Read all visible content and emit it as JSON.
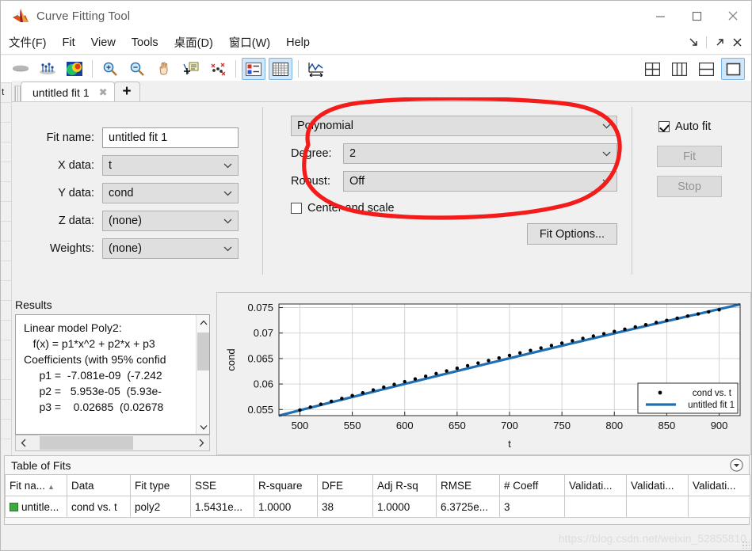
{
  "window": {
    "title": "Curve Fitting Tool",
    "logo_icon": "matlab-logo-icon",
    "minimize_icon": "minimize-icon",
    "maximize_icon": "maximize-icon",
    "close_icon": "close-icon"
  },
  "menubar": {
    "items": [
      {
        "label": "文件(F)",
        "name": "menu-file"
      },
      {
        "label": "Fit",
        "name": "menu-fit"
      },
      {
        "label": "View",
        "name": "menu-view"
      },
      {
        "label": "Tools",
        "name": "menu-tools"
      },
      {
        "label": "桌面(D)",
        "name": "menu-desktop"
      },
      {
        "label": "窗口(W)",
        "name": "menu-window"
      },
      {
        "label": "Help",
        "name": "menu-help"
      }
    ],
    "right_buttons": [
      {
        "name": "dock-arrow-icon"
      },
      {
        "name": "undock-arrow-icon"
      },
      {
        "name": "close-panel-icon"
      }
    ]
  },
  "toolbar": {
    "buttons": [
      {
        "name": "surface-plot-icon"
      },
      {
        "name": "residuals-plot-icon"
      },
      {
        "name": "contour-plot-icon"
      },
      {
        "name": "zoom-in-icon"
      },
      {
        "name": "zoom-out-icon"
      },
      {
        "name": "pan-icon"
      },
      {
        "name": "data-cursor-icon"
      },
      {
        "name": "exclude-outliers-icon"
      },
      {
        "name": "legend-toggle-icon"
      },
      {
        "name": "grid-toggle-icon"
      },
      {
        "name": "axis-limits-icon"
      }
    ],
    "selected": [
      "legend-toggle-icon",
      "grid-toggle-icon"
    ],
    "layout_buttons": [
      {
        "name": "layout-four-pane-icon",
        "selected": false
      },
      {
        "name": "layout-two-column-icon",
        "selected": false
      },
      {
        "name": "layout-two-row-icon",
        "selected": false
      },
      {
        "name": "layout-single-pane-icon",
        "selected": true
      }
    ]
  },
  "tabs": {
    "items": [
      {
        "label": "untitled fit 1",
        "close_icon": "tab-close-icon"
      }
    ],
    "add_label": "+"
  },
  "fit_form": {
    "fit_name_label": "Fit name:",
    "fit_name_value": "untitled fit 1",
    "x_data_label": "X data:",
    "x_data_value": "t",
    "y_data_label": "Y data:",
    "y_data_value": "cond",
    "z_data_label": "Z data:",
    "z_data_value": "(none)",
    "weights_label": "Weights:",
    "weights_value": "(none)"
  },
  "fit_type": {
    "model_value": "Polynomial",
    "degree_label": "Degree:",
    "degree_value": "2",
    "robust_label": "Robust:",
    "robust_value": "Off",
    "center_scale_label": "Center and scale",
    "center_scale_checked": false,
    "fit_options_label": "Fit Options..."
  },
  "fit_actions": {
    "auto_fit_label": "Auto fit",
    "auto_fit_checked": true,
    "fit_button_label": "Fit",
    "stop_button_label": "Stop"
  },
  "results": {
    "title": "Results",
    "text": "Linear model Poly2:\n   f(x) = p1*x^2 + p2*x + p3\nCoefficients (with 95% confid\n     p1 =  -7.081e-09  (-7.242\n     p2 =   5.953e-05  (5.93e-\n     p3 =    0.02685  (0.02678",
    "scroll_up_icon": "scroll-up-icon",
    "scroll_down_icon": "scroll-down-icon",
    "scroll_left_icon": "scroll-left-icon",
    "scroll_right_icon": "scroll-right-icon"
  },
  "table_of_fits": {
    "title": "Table of Fits",
    "collapse_icon": "collapse-down-icon",
    "columns": [
      "Fit na...",
      "Data",
      "Fit type",
      "SSE",
      "R-square",
      "DFE",
      "Adj R-sq",
      "RMSE",
      "# Coeff",
      "Validati...",
      "Validati...",
      "Validati..."
    ],
    "sorted_column": "Fit na...",
    "rows": [
      {
        "swatch_color": "#3faa3f",
        "cells": [
          "untitle...",
          "cond vs. t",
          "poly2",
          "1.5431e...",
          "1.0000",
          "38",
          "1.0000",
          "6.3725e...",
          "3",
          "",
          "",
          ""
        ]
      }
    ]
  },
  "annotation": {
    "type": "red-ellipse-highlight",
    "color": "#f41b1b"
  },
  "watermark": {
    "text": "https://blog.csdn.net/weixin_52855810"
  },
  "chart_data": {
    "type": "scatter",
    "title": "",
    "xlabel": "t",
    "ylabel": "cond",
    "xlim": [
      480,
      920
    ],
    "ylim": [
      0.0538,
      0.0757
    ],
    "xticks": [
      500,
      550,
      600,
      650,
      700,
      750,
      800,
      850,
      900
    ],
    "yticks": [
      0.055,
      0.06,
      0.065,
      0.07,
      0.075
    ],
    "ytick_labels": [
      "0.055",
      "0.06",
      "0.065",
      "0.07",
      "0.075"
    ],
    "grid": true,
    "legend_position": "lower right",
    "series": [
      {
        "name": "cond vs. t",
        "type": "scatter",
        "marker": "circle",
        "color": "#000000",
        "x": [
          500,
          510,
          520,
          530,
          540,
          550,
          560,
          570,
          580,
          590,
          600,
          610,
          620,
          630,
          640,
          650,
          660,
          670,
          680,
          690,
          700,
          710,
          720,
          730,
          740,
          750,
          760,
          770,
          780,
          790,
          800,
          810,
          820,
          830,
          840,
          850,
          860,
          870,
          880,
          890,
          900
        ],
        "y": [
          0.0549,
          0.05547,
          0.05604,
          0.05661,
          0.05717,
          0.05773,
          0.05828,
          0.05883,
          0.05938,
          0.05992,
          0.06046,
          0.06099,
          0.06152,
          0.06205,
          0.06257,
          0.06309,
          0.0636,
          0.06411,
          0.06461,
          0.06511,
          0.06561,
          0.0661,
          0.06659,
          0.06707,
          0.06755,
          0.06802,
          0.06849,
          0.06895,
          0.06941,
          0.06987,
          0.07032,
          0.07076,
          0.0712,
          0.07164,
          0.07207,
          0.07249,
          0.07292,
          0.07333,
          0.07375,
          0.07415,
          0.07456
        ]
      },
      {
        "name": "untitled fit 1",
        "type": "line",
        "color": "#1f6fb4",
        "model": "p1*x^2 + p2*x + p3",
        "p1": -7.081e-09,
        "p2": 5.953e-05,
        "p3": 0.02685
      }
    ]
  }
}
